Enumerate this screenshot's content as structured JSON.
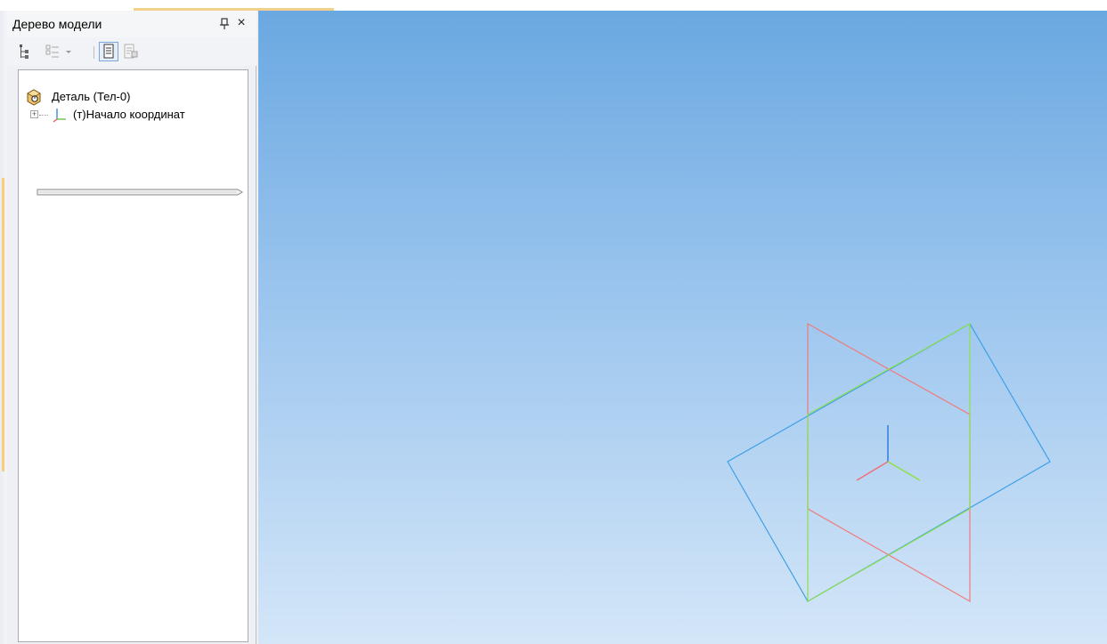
{
  "tree_panel": {
    "title": "Дерево модели",
    "pin_glyph": "ᵖ",
    "close_glyph": "×",
    "toolbar": [
      {
        "icon": "tree-structure-icon"
      },
      {
        "icon": "list-view-icon"
      },
      {
        "icon": "dropdown-arrow-icon"
      },
      {
        "icon": "document-view-icon",
        "active": true
      },
      {
        "icon": "document-properties-icon"
      }
    ],
    "items": [
      {
        "label": "Деталь (Тел-0)",
        "icon": "part-icon"
      },
      {
        "label": "(т)Начало координат",
        "icon": "coordinate-origin-icon",
        "expandable": true
      }
    ]
  },
  "viewport": {
    "background_top": "#6aa8e1",
    "background_bottom": "#d4e6f8",
    "planes": [
      {
        "name": "XY",
        "color": "#3da0e8"
      },
      {
        "name": "ZX",
        "color": "#ef7b7b"
      },
      {
        "name": "ZY",
        "color": "#8ee04a"
      }
    ],
    "axes": [
      {
        "axis": "Z",
        "color": "#2e7fd8"
      },
      {
        "axis": "X",
        "color": "#ef6f7a"
      },
      {
        "axis": "Y",
        "color": "#8ee04a"
      }
    ]
  }
}
